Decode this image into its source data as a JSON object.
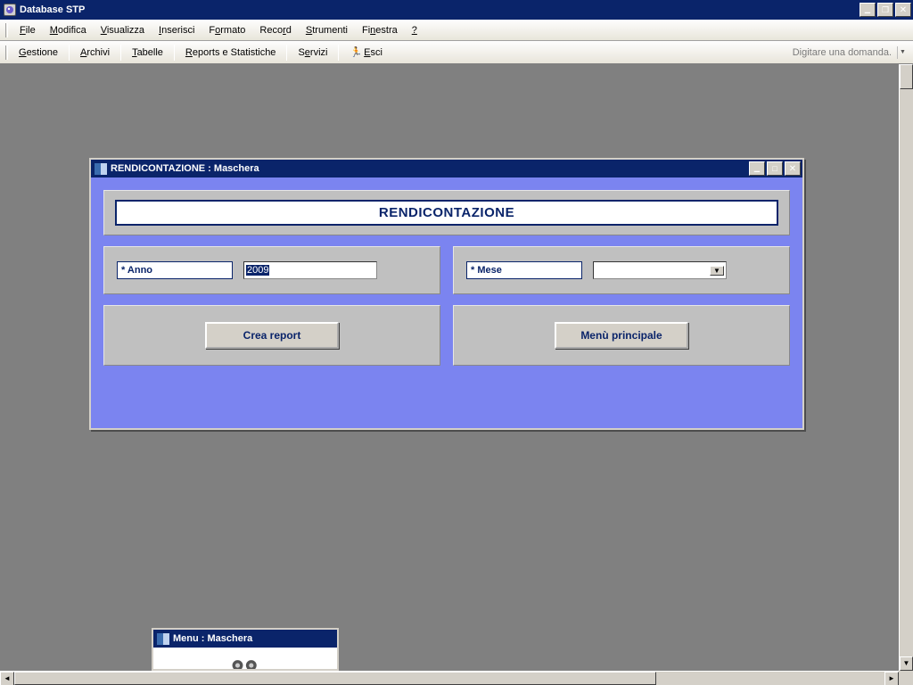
{
  "app": {
    "title": "Database STP"
  },
  "menubar": {
    "file": "File",
    "modifica": "Modifica",
    "visualizza": "Visualizza",
    "inserisci": "Inserisci",
    "formato": "Formato",
    "record": "Record",
    "strumenti": "Strumenti",
    "finestra": "Finestra",
    "help": "?"
  },
  "toolbar": {
    "gestione": "Gestione",
    "archivi": "Archivi",
    "tabelle": "Tabelle",
    "reports": "Reports e Statistiche",
    "servizi": "Servizi",
    "esci": "Esci",
    "ask": "Digitare una domanda."
  },
  "form": {
    "title": "RENDICONTAZIONE : Maschera",
    "heading": "RENDICONTAZIONE",
    "anno_label": "* Anno",
    "anno_value": "2009",
    "mese_label": "* Mese",
    "mese_value": "",
    "crea_report": "Crea report",
    "menu_principale": "Menù principale"
  },
  "mini": {
    "title": "Menu : Maschera"
  }
}
